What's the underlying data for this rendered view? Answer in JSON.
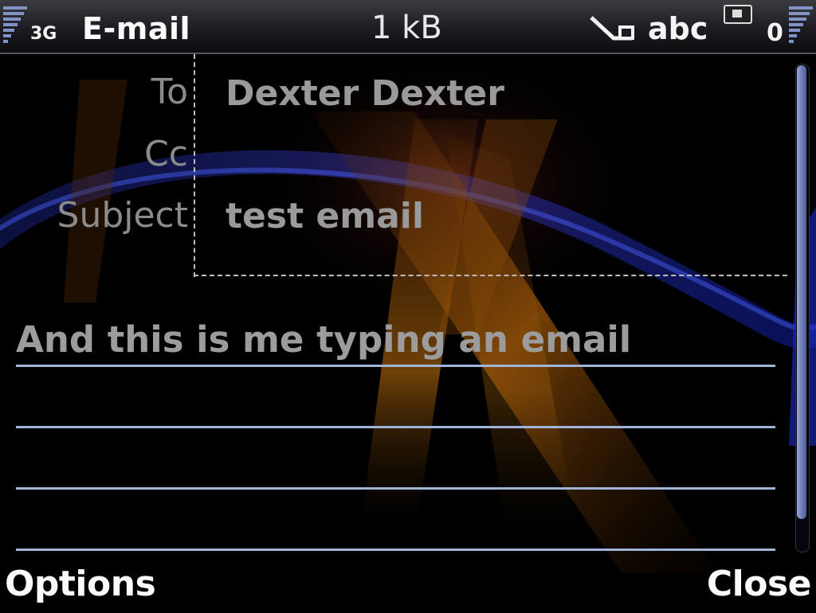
{
  "status_bar": {
    "network_type": "3G",
    "app_title": "E-mail",
    "message_size": "1 kB",
    "input_mode": "abc",
    "battery_count": "0",
    "icons": [
      "signal-strength-icon",
      "pen-input-icon",
      "message-icon",
      "battery-icon"
    ]
  },
  "header_fields": {
    "to_label": "To",
    "to_value": "Dexter Dexter",
    "cc_label": "Cc",
    "cc_value": "",
    "subject_label": "Subject",
    "subject_value": "test email"
  },
  "body": {
    "text": "And this is me typing an email"
  },
  "softkeys": {
    "left": "Options",
    "right": "Close"
  },
  "colors": {
    "status_bar": "#1c1c22",
    "label_text": "#8b8b8b",
    "value_text": "#9a9a9a",
    "rule_line": "#9fb4d6",
    "scroll_thumb": "#6d7fb6"
  }
}
